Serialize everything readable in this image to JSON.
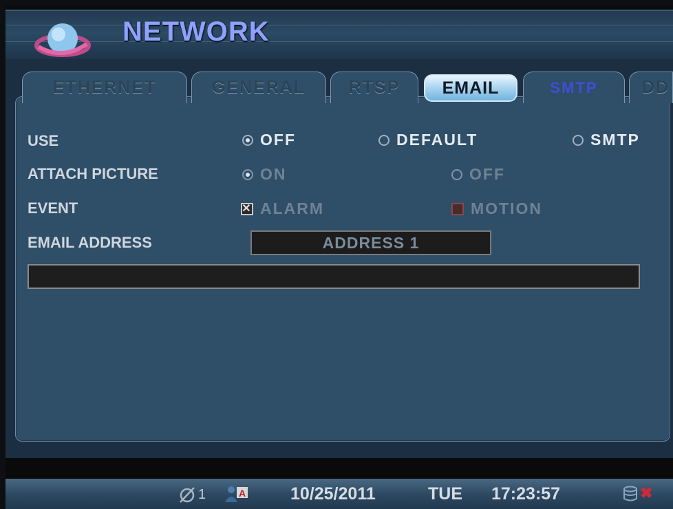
{
  "header": {
    "title": "NETWORK",
    "icon": "globe-icon"
  },
  "tabs": [
    {
      "label": "ETHERNET",
      "active": false
    },
    {
      "label": "GENERAL",
      "active": false
    },
    {
      "label": "RTSP",
      "active": false
    },
    {
      "label": "EMAIL",
      "active": true
    },
    {
      "label": "SMTP",
      "active": false
    },
    {
      "label": "DD",
      "active": false
    }
  ],
  "form": {
    "use": {
      "label": "USE",
      "options": [
        "OFF",
        "DEFAULT",
        "SMTP"
      ],
      "selected": "OFF"
    },
    "attach_picture": {
      "label": "ATTACH PICTURE",
      "options": [
        "ON",
        "OFF"
      ],
      "selected": "ON"
    },
    "event": {
      "label": "EVENT",
      "alarm": "ALARM",
      "alarm_checked": true,
      "motion": "MOTION",
      "motion_checked": false
    },
    "email_address": {
      "label": "EMAIL ADDRESS",
      "selected": "ADDRESS 1",
      "value": ""
    }
  },
  "status": {
    "camera_count": "1",
    "date": "10/25/2011",
    "day": "TUE",
    "time": "17:23:57",
    "icons": [
      "no-camera-icon",
      "user-admin-icon",
      "database-icon",
      "error-x-icon"
    ]
  },
  "colors": {
    "accent": "#8fa0ff",
    "smtp_tab": "#3f4fd6",
    "panel": "#2f4e68"
  }
}
